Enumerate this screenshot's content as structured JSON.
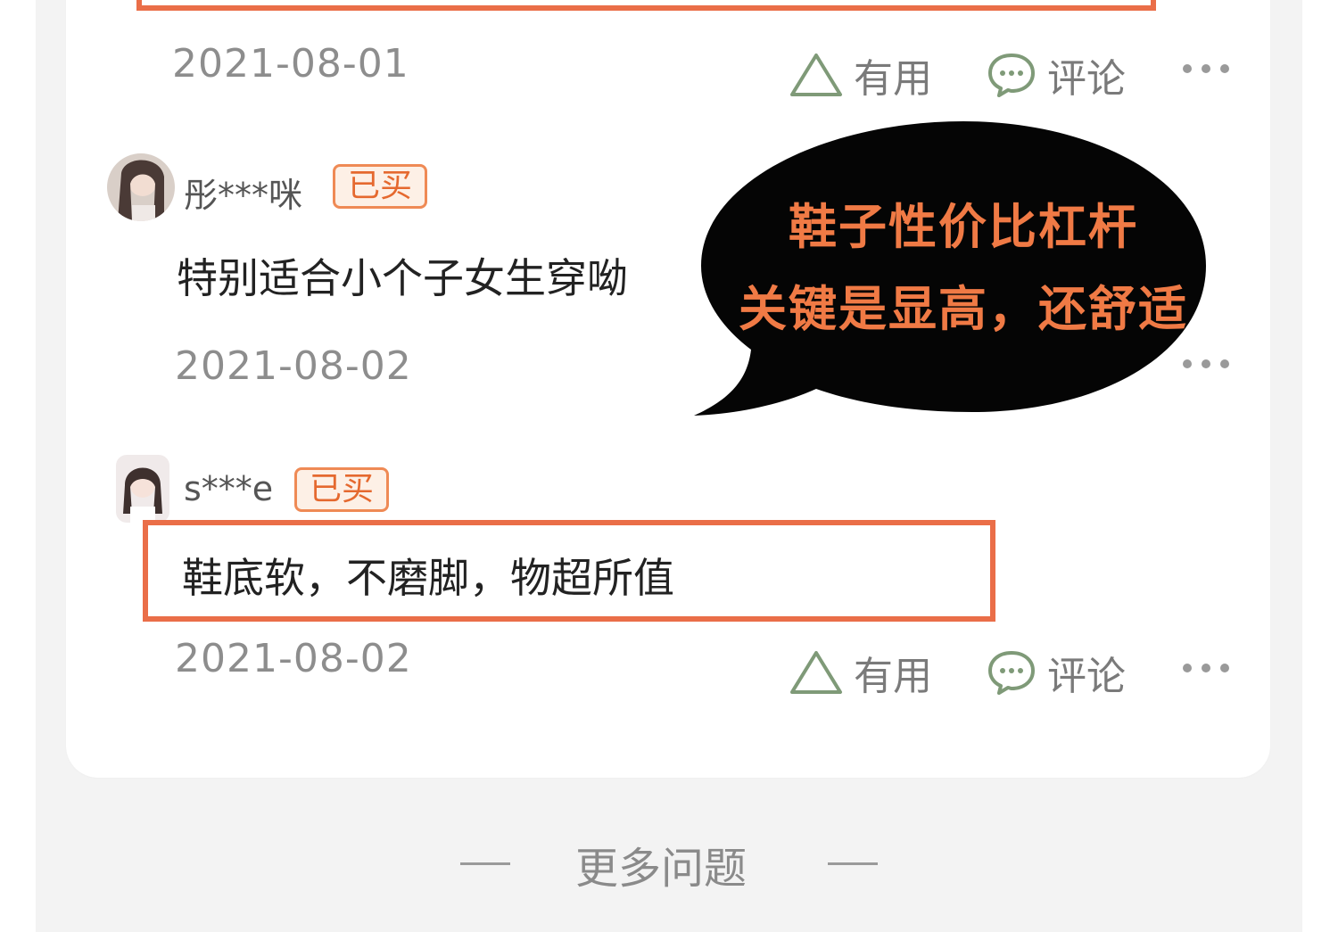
{
  "reviews": [
    {
      "date": "2021-08-01",
      "actions": {
        "useful_label": "有用",
        "comment_label": "评论"
      }
    },
    {
      "username": "彤***咪",
      "badge": "已买",
      "text": "特别适合小个子女生穿呦",
      "date": "2021-08-02"
    },
    {
      "username": "s***e",
      "badge": "已买",
      "text": "鞋底软，不磨脚，物超所值",
      "date": "2021-08-02",
      "actions": {
        "useful_label": "有用",
        "comment_label": "评论"
      }
    }
  ],
  "callout": {
    "line1": "鞋子性价比杠杆",
    "line2": "关键是显高，还舒适"
  },
  "footer": {
    "more_label": "更多问题"
  },
  "colors": {
    "accent": "#ea6e48",
    "badge_text": "#e5692f",
    "action_icon": "#7f9a78",
    "date_text": "#8d8d8d"
  },
  "icons": [
    "triangle-up-icon",
    "comment-bubble-icon",
    "more-dots-icon"
  ]
}
